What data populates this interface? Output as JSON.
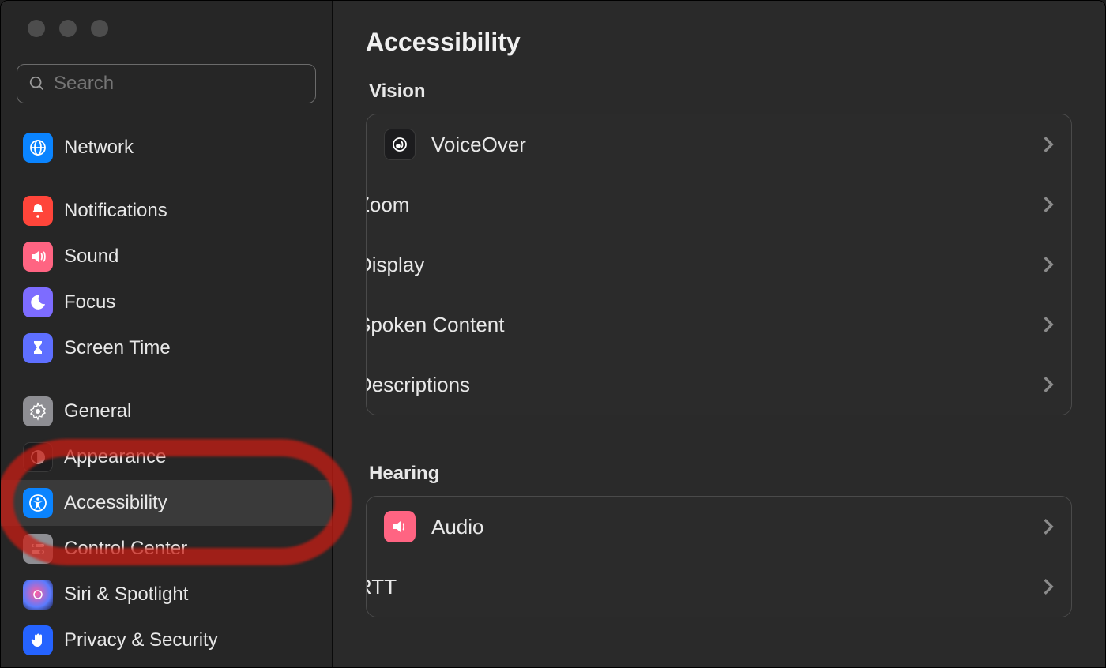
{
  "search": {
    "placeholder": "Search"
  },
  "page_title": "Accessibility",
  "sidebar": {
    "items": [
      {
        "label": "Network"
      },
      {
        "label": "Notifications"
      },
      {
        "label": "Sound"
      },
      {
        "label": "Focus"
      },
      {
        "label": "Screen Time"
      },
      {
        "label": "General"
      },
      {
        "label": "Appearance"
      },
      {
        "label": "Accessibility"
      },
      {
        "label": "Control Center"
      },
      {
        "label": "Siri & Spotlight"
      },
      {
        "label": "Privacy & Security"
      }
    ]
  },
  "sections": {
    "vision": {
      "heading": "Vision",
      "rows": [
        {
          "label": "VoiceOver"
        },
        {
          "label": "Zoom"
        },
        {
          "label": "Display"
        },
        {
          "label": "Spoken Content"
        },
        {
          "label": "Descriptions"
        }
      ]
    },
    "hearing": {
      "heading": "Hearing",
      "rows": [
        {
          "label": "Audio"
        },
        {
          "label": "RTT"
        }
      ]
    }
  }
}
